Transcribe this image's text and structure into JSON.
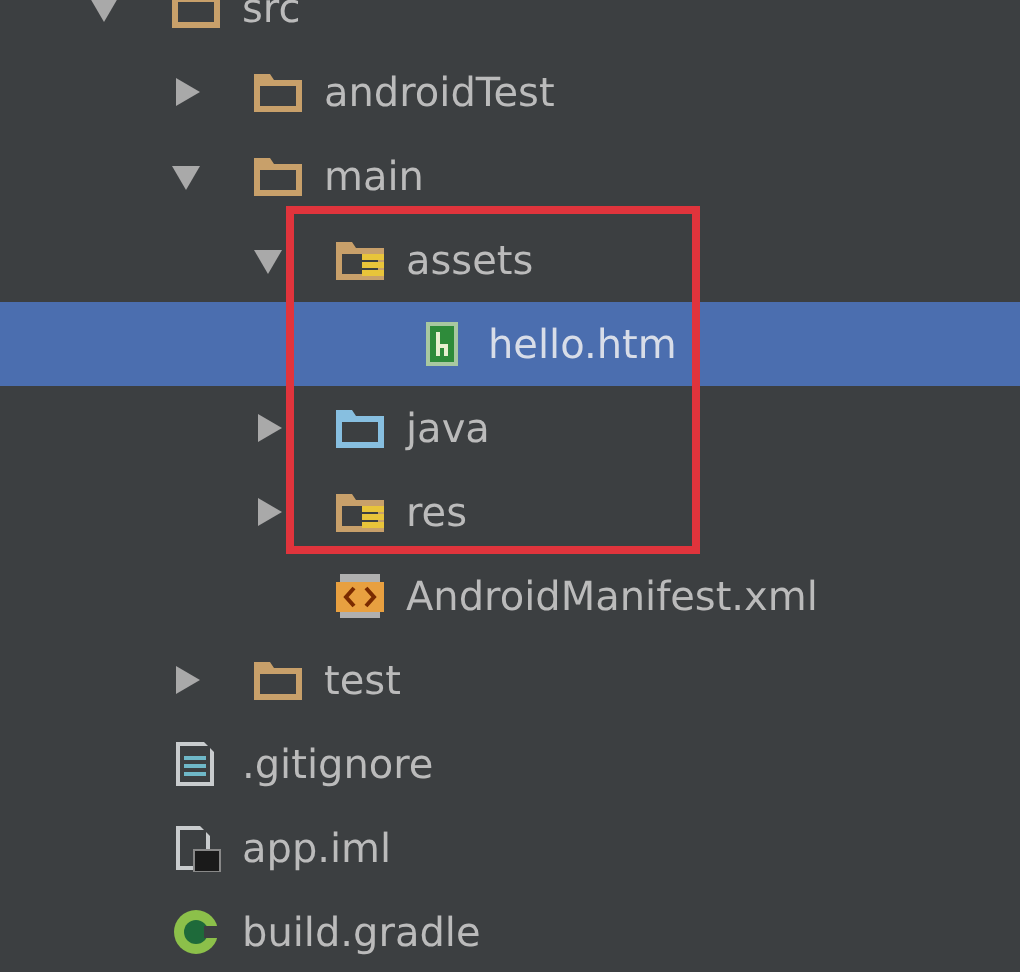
{
  "tree": [
    {
      "label": "src",
      "kind": "folder",
      "expanded": true,
      "selected": false,
      "children": [
        {
          "label": "androidTest",
          "kind": "folder",
          "expanded": false,
          "selected": false
        },
        {
          "label": "main",
          "kind": "folder",
          "expanded": true,
          "selected": false,
          "children": [
            {
              "label": "assets",
              "kind": "resource-folder",
              "expanded": true,
              "selected": false,
              "children": [
                {
                  "label": "hello.htm",
                  "kind": "html",
                  "selected": true
                }
              ]
            },
            {
              "label": "java",
              "kind": "source-folder",
              "expanded": false,
              "selected": false
            },
            {
              "label": "res",
              "kind": "resource-folder",
              "expanded": false,
              "selected": false
            },
            {
              "label": "AndroidManifest.xml",
              "kind": "xml",
              "selected": false
            }
          ]
        },
        {
          "label": "test",
          "kind": "folder",
          "expanded": false,
          "selected": false
        }
      ]
    },
    {
      "label": ".gitignore",
      "kind": "text",
      "selected": false
    },
    {
      "label": "app.iml",
      "kind": "iml",
      "selected": false
    },
    {
      "label": "build.gradle",
      "kind": "gradle",
      "selected": false
    }
  ],
  "annotation": {
    "color": "#e0343c"
  }
}
